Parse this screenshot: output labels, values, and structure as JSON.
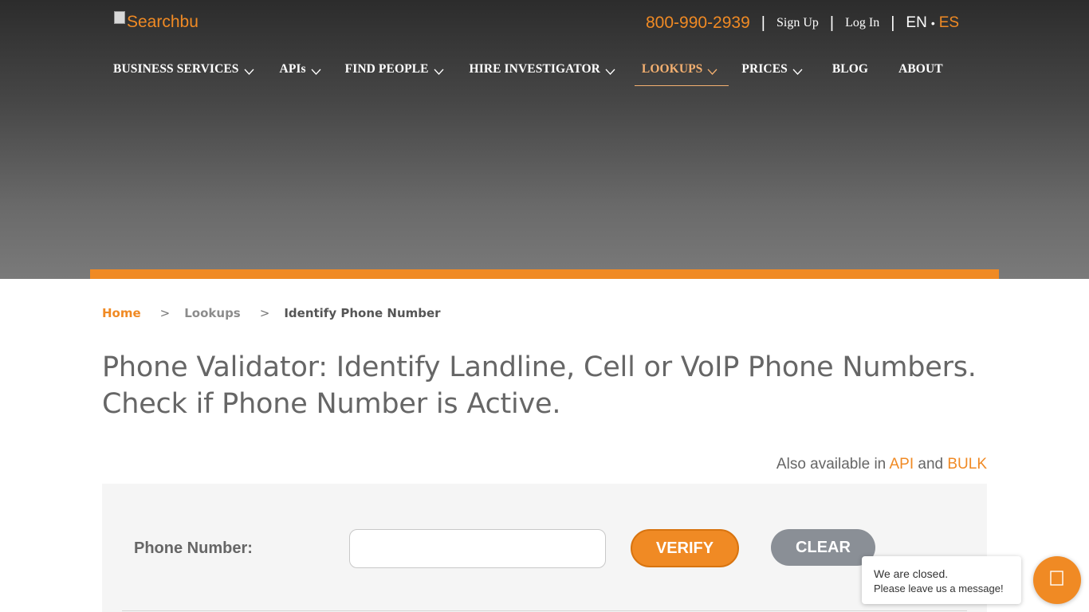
{
  "header": {
    "logo_text": "Searchbu",
    "phone": "800-990-2939",
    "sign_up": "Sign Up",
    "log_in": "Log In",
    "lang_en": "EN",
    "lang_sep": "•",
    "lang_es": "ES",
    "separator": "|"
  },
  "nav": {
    "items": [
      {
        "label": "BUSINESS SERVICES",
        "dropdown": true
      },
      {
        "label": "APIs",
        "dropdown": true
      },
      {
        "label": "FIND PEOPLE",
        "dropdown": true
      },
      {
        "label": "HIRE INVESTIGATOR",
        "dropdown": true
      },
      {
        "label": "LOOKUPS",
        "dropdown": true,
        "active": true
      },
      {
        "label": "PRICES",
        "dropdown": true
      },
      {
        "label": "BLOG",
        "dropdown": false
      },
      {
        "label": "ABOUT",
        "dropdown": false
      }
    ]
  },
  "breadcrumb": {
    "home": "Home",
    "sep": ">",
    "lookups": "Lookups",
    "current": "Identify Phone Number"
  },
  "page": {
    "title_line1": "Phone Validator: Identify Landline, Cell or VoIP Phone Numbers.",
    "title_line2": "Check if Phone Number is Active.",
    "also_prefix": "Also available in",
    "also_api": "API",
    "also_and": "and",
    "also_bulk": "BULK"
  },
  "form": {
    "phone_label": "Phone Number:",
    "phone_value": "",
    "verify_label": "VERIFY",
    "clear_label": "CLEAR"
  },
  "chat": {
    "line1": "We are closed.",
    "line2": "Please leave us a message!",
    "icon": "chat-icon"
  },
  "colors": {
    "accent": "#f08a24",
    "text_gray": "#666666",
    "clear_button": "#8a8f96"
  }
}
